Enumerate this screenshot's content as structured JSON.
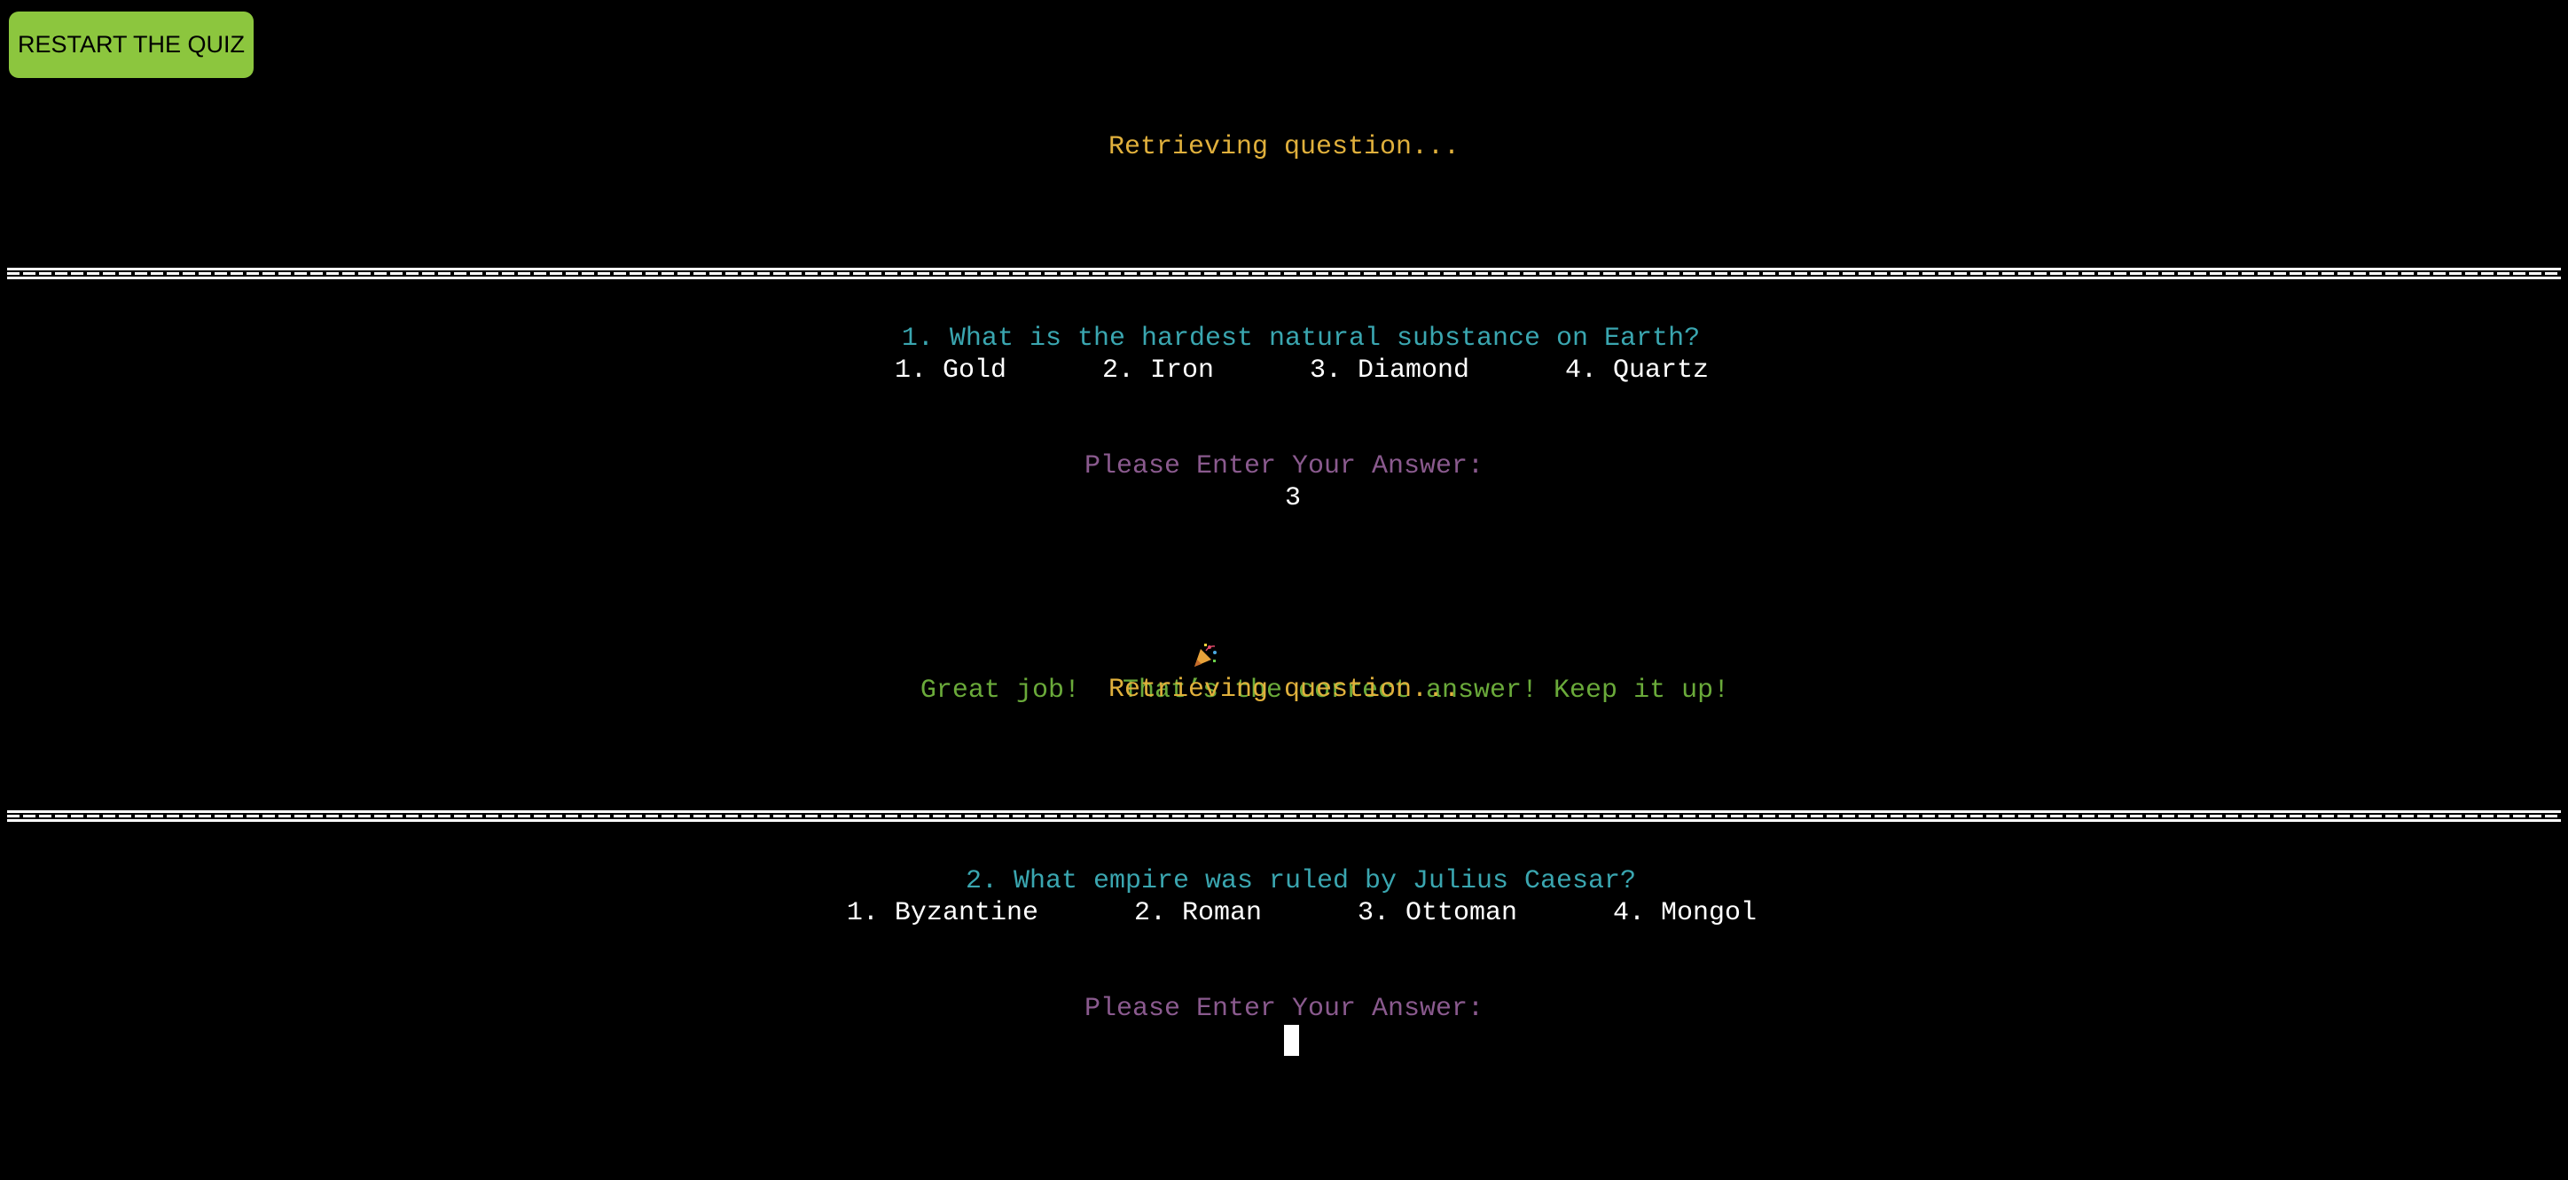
{
  "restart_button": {
    "label": "RESTART THE QUIZ"
  },
  "colors": {
    "button_green": "#8cc63e",
    "status_yellow": "#e0b03c",
    "question_cyan": "#3aa6b0",
    "prompt_purple": "#8a5a8e",
    "feedback_green": "#6aaa3a"
  },
  "terminal": {
    "status_1": "Retrieving question...",
    "question_1": {
      "text": "1. What is the hardest natural substance on Earth?",
      "options": [
        "1. Gold",
        "2. Iron",
        "3. Diamond",
        "4. Quartz"
      ],
      "prompt": "Please Enter Your Answer:",
      "answer": "3",
      "feedback_prefix": "Great job! ",
      "feedback_icon": "party-popper-icon",
      "feedback_suffix": "That’s the correct answer! Keep it up!"
    },
    "status_2": "Retrieving question...",
    "question_2": {
      "text": "2. What empire was ruled by Julius Caesar?",
      "options": [
        "1. Byzantine",
        "2. Roman",
        "3. Ottoman",
        "4. Mongol"
      ],
      "prompt": "Please Enter Your Answer:",
      "answer": ""
    }
  }
}
